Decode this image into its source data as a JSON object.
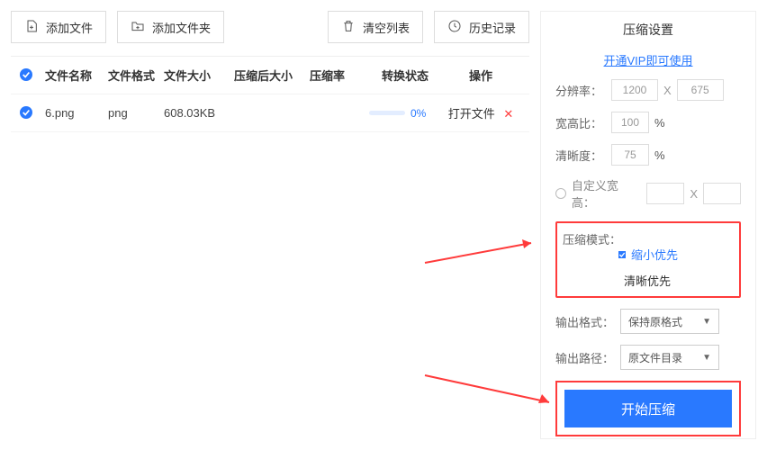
{
  "toolbar": {
    "add_file": "添加文件",
    "add_folder": "添加文件夹",
    "clear_list": "清空列表",
    "history": "历史记录"
  },
  "table": {
    "headers": {
      "name": "文件名称",
      "format": "文件格式",
      "size": "文件大小",
      "after": "压缩后大小",
      "ratio": "压缩率",
      "status": "转换状态",
      "op": "操作"
    },
    "rows": [
      {
        "name": "6.png",
        "format": "png",
        "size": "608.03KB",
        "after": "",
        "ratio": "",
        "percent": "0%",
        "op_open": "打开文件"
      }
    ]
  },
  "side": {
    "title": "压缩设置",
    "vip": "开通VIP即可使用",
    "resolution_label": "分辨率：",
    "resolution_w": "1200",
    "resolution_h": "675",
    "x_sep": "X",
    "aspect_label": "宽高比：",
    "aspect_val": "100",
    "pct": "%",
    "clarity_label": "清晰度：",
    "clarity_val": "75",
    "custom_wh": "自定义宽高：",
    "mode_label": "压缩模式：",
    "mode_shrink": "缩小优先",
    "mode_clear": "清晰优先",
    "out_fmt_label": "输出格式：",
    "out_fmt_val": "保持原格式",
    "out_path_label": "输出路径：",
    "out_path_val": "原文件目录",
    "start": "开始压缩"
  }
}
